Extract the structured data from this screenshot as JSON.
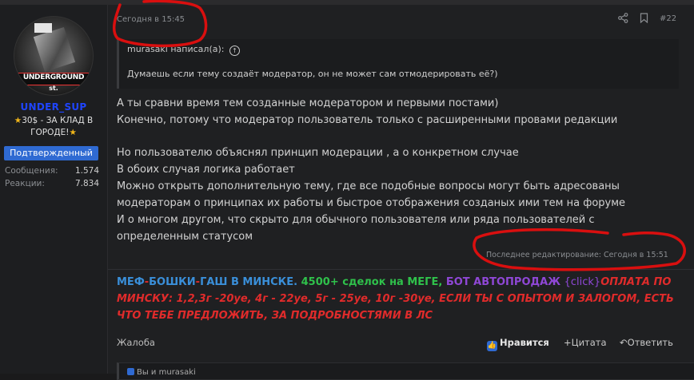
{
  "user": {
    "avatar_text": "UNDERGROUND",
    "avatar_subtext": "st.",
    "name": "UNDER_SUP",
    "title": "30$ - ЗА КЛАД В ГОРОДЕ!",
    "badge": "Подтвержденный",
    "stats": [
      {
        "label": "Сообщения:",
        "value": "1.574"
      },
      {
        "label": "Реакции:",
        "value": "7.834"
      }
    ]
  },
  "post": {
    "date": "Сегодня в 15:45",
    "number": "#22",
    "quote": {
      "author": "murasaki написал(а):",
      "text": "Думаешь если тему создаёт модератор, он не может сам отмодерировать её?)"
    },
    "lines": [
      "А ты сравни время тем созданные модератором и первыми постами)",
      "Конечно, потому что модератор пользователь только с расширенными провами редакции",
      "Но пользователю объяснял принцип модерации , а о конкретном случае",
      "В обоих случая логика работает",
      "Можно открыть дополнительную тему, где все подобные вопросы могут быть адресованы",
      "модераторам о принципах их работы и быстрое отображения созданых ими тем на форуме",
      "И о многом другом, что скрыто для обычного пользователя или ряда пользователей с",
      "определенным статусом"
    ],
    "last_edit": "Последнее редактирование: Сегодня в 15:51"
  },
  "signature": {
    "s1": "МЕФ",
    "s2": "-",
    "s3": "БОШКИ",
    "s4": "-",
    "s5": "ГАШ В МИНСКЕ.",
    "s6": "4500+",
    "s7": "сделок на МЕГЕ,",
    "s8": "БОТ АВТОПРОДАЖ",
    "s9": "{click}",
    "s10": "ОПЛАТА ПО",
    "line2": "МИНСКУ: 1,2,3г -20уе, 4г - 22уе, 5г - 25уе, 10г -30уе, ЕСЛИ ТЫ С ОПЫТОМ И ЗАЛОГОМ, ЕСТЬ",
    "line3": "ЧТО ТЕБЕ ПРЕДЛОЖИТЬ, ЗА ПОДРОБНОСТЯМИ В ЛС"
  },
  "actions": {
    "report": "Жалоба",
    "like": "Нравится",
    "quote": "Цитата",
    "reply": "Ответить"
  },
  "likes": "Вы и murasaki",
  "colors": {
    "verified": "#2f6ad2",
    "username": "#1f45ff",
    "sig_blue": "#3a8fd9",
    "sig_red": "#e02b2b",
    "sig_green": "#2fc14b",
    "sig_purple": "#8f47d6",
    "annotation": "#d90f0f"
  }
}
